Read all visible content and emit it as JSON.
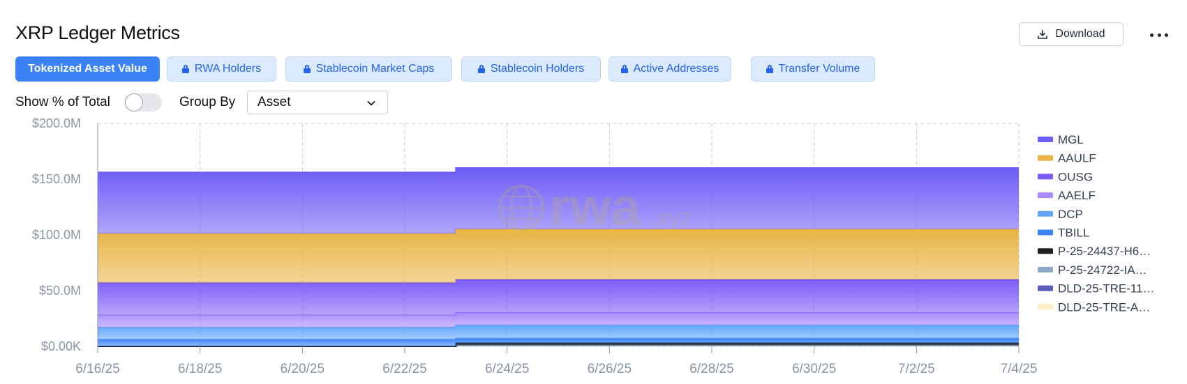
{
  "header": {
    "title": "XRP Ledger Metrics",
    "download_label": "Download"
  },
  "tabs": [
    {
      "label": "Tokenized Asset Value",
      "active": true,
      "locked": false
    },
    {
      "label": "RWA Holders",
      "active": false,
      "locked": true
    },
    {
      "label": "Stablecoin Market Caps",
      "active": false,
      "locked": true
    },
    {
      "label": "Stablecoin Holders",
      "active": false,
      "locked": true
    },
    {
      "label": "Active Addresses",
      "active": false,
      "locked": true
    },
    {
      "label": "Transfer Volume",
      "active": false,
      "locked": true
    }
  ],
  "controls": {
    "show_pct_label": "Show % of Total",
    "show_pct_on": false,
    "group_by_label": "Group By",
    "group_by_value": "Asset"
  },
  "watermark": {
    "main": "rwa",
    "suffix": ".xyz"
  },
  "chart_data": {
    "type": "area",
    "stacked": true,
    "xlabel": "",
    "ylabel": "",
    "ylim": [
      0,
      200000000
    ],
    "y_ticks": [
      0,
      50000000,
      100000000,
      150000000,
      200000000
    ],
    "y_tick_labels": [
      "$0.00K",
      "$50.0M",
      "$100.0M",
      "$150.0M",
      "$200.0M"
    ],
    "x": [
      "2025-06-16",
      "2025-06-17",
      "2025-06-18",
      "2025-06-19",
      "2025-06-20",
      "2025-06-21",
      "2025-06-22",
      "2025-06-23",
      "2025-06-24",
      "2025-06-25",
      "2025-06-26",
      "2025-06-27",
      "2025-06-28",
      "2025-06-29",
      "2025-06-30",
      "2025-07-01",
      "2025-07-02",
      "2025-07-03",
      "2025-07-04"
    ],
    "x_ticks": [
      "2025-06-16",
      "2025-06-18",
      "2025-06-20",
      "2025-06-22",
      "2025-06-24",
      "2025-06-26",
      "2025-06-28",
      "2025-06-30",
      "2025-07-02",
      "2025-07-04"
    ],
    "x_tick_labels": [
      "6/16/25",
      "6/18/25",
      "6/20/25",
      "6/22/25",
      "6/24/25",
      "6/26/25",
      "6/28/25",
      "6/30/25",
      "7/2/25",
      "7/4/25"
    ],
    "grid": true,
    "legend_position": "right",
    "series": [
      {
        "name": "DLD-25-TRE-A…",
        "color": "#fdf0c2",
        "values": [
          0,
          0,
          0,
          0,
          0,
          0,
          0,
          0,
          0,
          0,
          0,
          0,
          0,
          0,
          0,
          0,
          0,
          0,
          0
        ]
      },
      {
        "name": "DLD-25-TRE-11…",
        "color": "#5b5bb8",
        "values": [
          0,
          0,
          0,
          0,
          0,
          0,
          0,
          0,
          0,
          0,
          0,
          0,
          0,
          0,
          0,
          0,
          0,
          0,
          0
        ]
      },
      {
        "name": "P-25-24722-IA…",
        "color": "#8aa8c8",
        "values": [
          0,
          0,
          0,
          0,
          0,
          0,
          0,
          1000000,
          1000000,
          1000000,
          1000000,
          1000000,
          1000000,
          1000000,
          1000000,
          1000000,
          1000000,
          1000000,
          1000000
        ]
      },
      {
        "name": "P-25-24437-H6…",
        "color": "#1f1f1f",
        "values": [
          0,
          0,
          0,
          0,
          0,
          0,
          0,
          2000000,
          2000000,
          2000000,
          2000000,
          2000000,
          2000000,
          2000000,
          2000000,
          2000000,
          2000000,
          2000000,
          2000000
        ]
      },
      {
        "name": "TBILL",
        "color": "#3b82f6",
        "values": [
          6000000,
          6000000,
          6000000,
          6000000,
          6000000,
          6000000,
          6000000,
          4000000,
          4000000,
          4000000,
          4000000,
          4000000,
          4000000,
          4000000,
          4000000,
          4000000,
          4000000,
          4000000,
          4000000
        ]
      },
      {
        "name": "DCP",
        "color": "#60a5fa",
        "values": [
          11000000,
          11000000,
          11000000,
          11000000,
          11000000,
          11000000,
          11000000,
          12000000,
          12000000,
          12000000,
          12000000,
          12000000,
          12000000,
          12000000,
          12000000,
          12000000,
          12000000,
          12000000,
          12000000
        ]
      },
      {
        "name": "AAELF",
        "color": "#a78bfa",
        "values": [
          11000000,
          11000000,
          11000000,
          11000000,
          11000000,
          11000000,
          11000000,
          11000000,
          11000000,
          11000000,
          11000000,
          11000000,
          11000000,
          11000000,
          11000000,
          11000000,
          11000000,
          11000000,
          11000000
        ]
      },
      {
        "name": "OUSG",
        "color": "#7c5cf5",
        "values": [
          29000000,
          29000000,
          29000000,
          29000000,
          29000000,
          29000000,
          29000000,
          30000000,
          30000000,
          30000000,
          30000000,
          30000000,
          30000000,
          30000000,
          30000000,
          30000000,
          30000000,
          30000000,
          30000000
        ]
      },
      {
        "name": "AAULF",
        "color": "#e8b443",
        "values": [
          44000000,
          44000000,
          44000000,
          44000000,
          44000000,
          44000000,
          44000000,
          45000000,
          45000000,
          45000000,
          45000000,
          45000000,
          45000000,
          45000000,
          45000000,
          45000000,
          45000000,
          45000000,
          45000000
        ]
      },
      {
        "name": "MGL",
        "color": "#6d5cf6",
        "values": [
          55000000,
          55000000,
          55000000,
          55000000,
          55000000,
          55000000,
          55000000,
          55000000,
          55000000,
          55000000,
          55000000,
          55000000,
          55000000,
          55000000,
          55000000,
          55000000,
          55000000,
          55000000,
          55000000
        ]
      }
    ],
    "legend_order": [
      "MGL",
      "AAULF",
      "OUSG",
      "AAELF",
      "DCP",
      "TBILL",
      "P-25-24437-H6…",
      "P-25-24722-IA…",
      "DLD-25-TRE-11…",
      "DLD-25-TRE-A…"
    ]
  }
}
